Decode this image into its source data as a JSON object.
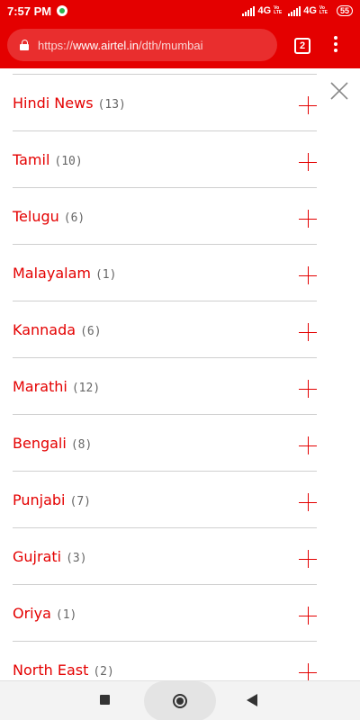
{
  "status_bar": {
    "time": "7:57 PM",
    "network1": "4G",
    "network2": "4G",
    "volte_top": "Vo",
    "volte_bottom": "LTE",
    "battery": "55"
  },
  "browser": {
    "url_scheme": "https://",
    "url_host": "www.airtel.in",
    "url_path": "/dth/mumbai",
    "tab_count": "2"
  },
  "colors": {
    "brand_red": "#e40000",
    "divider": "#cfcfcf"
  },
  "list": {
    "items": [
      {
        "label": "Hindi News",
        "count": "(13)"
      },
      {
        "label": "Tamil",
        "count": "(10)"
      },
      {
        "label": "Telugu",
        "count": "(6)"
      },
      {
        "label": "Malayalam",
        "count": "(1)"
      },
      {
        "label": "Kannada",
        "count": "(6)"
      },
      {
        "label": "Marathi",
        "count": "(12)"
      },
      {
        "label": "Bengali",
        "count": "(8)"
      },
      {
        "label": "Punjabi",
        "count": "(7)"
      },
      {
        "label": "Gujrati",
        "count": "(3)"
      },
      {
        "label": "Oriya",
        "count": "(1)"
      },
      {
        "label": "North East",
        "count": "(2)"
      }
    ]
  },
  "icons": {
    "close": "close-icon",
    "expand": "plus-icon",
    "lock": "lock-icon",
    "menu": "more-vert-icon"
  }
}
